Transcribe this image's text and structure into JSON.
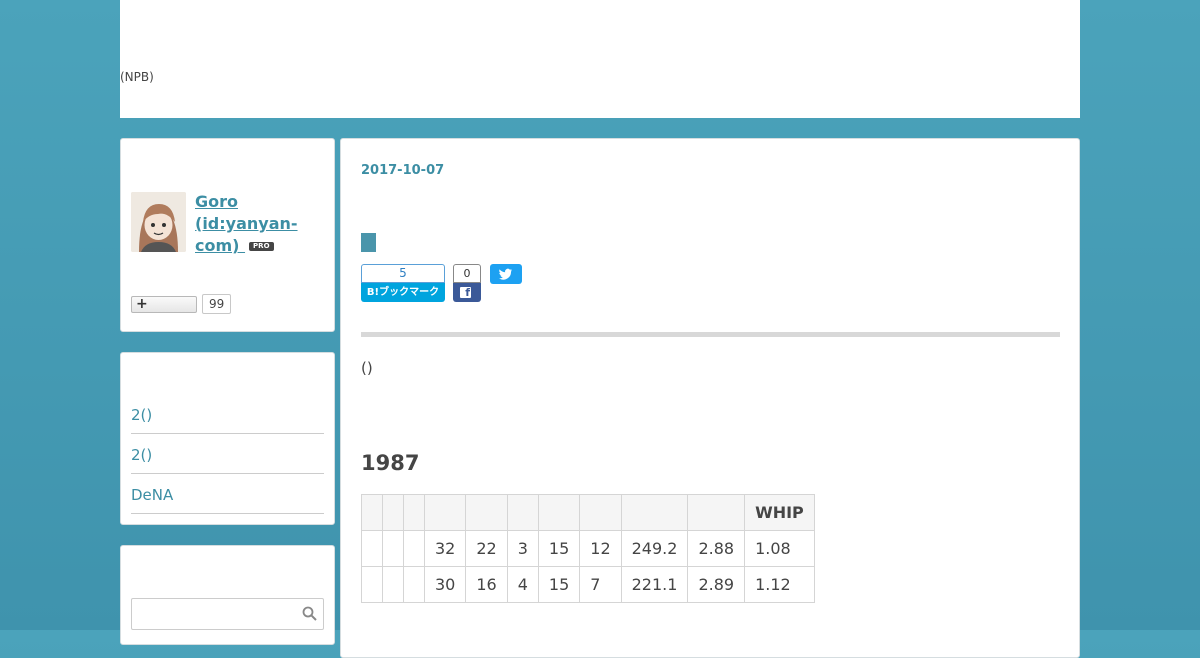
{
  "header": {
    "tagline": "(NPB)"
  },
  "profile": {
    "username": "Goro (id:yanyan-com)",
    "pro_badge": "PRO",
    "follow_label": "+",
    "follow_count": "99"
  },
  "recent": {
    "items": [
      {
        "label": "2()"
      },
      {
        "label": "2()"
      },
      {
        "label": "DeNA"
      }
    ]
  },
  "search": {
    "placeholder": ""
  },
  "article": {
    "date": "2017-10-07",
    "hatena": {
      "count": "5",
      "label": "B!ブックマーク"
    },
    "facebook": {
      "count": "0"
    },
    "intro": "()",
    "section_title": "1987",
    "table": {
      "headers": [
        "",
        "",
        "",
        "",
        "",
        "",
        "",
        "",
        "",
        "",
        "WHIP"
      ],
      "rows": [
        [
          "",
          "",
          "",
          "32",
          "22",
          "3",
          "15",
          "12",
          "249.2",
          "2.88",
          "1.08"
        ],
        [
          "",
          "",
          "",
          "30",
          "16",
          "4",
          "15",
          "7",
          "221.1",
          "2.89",
          "1.12"
        ]
      ]
    }
  },
  "colors": {
    "accent": "#3c8ea4",
    "background": "#4aa0b8",
    "hatena": "#00a4de",
    "facebook": "#3b5998",
    "twitter": "#1da1f2"
  }
}
